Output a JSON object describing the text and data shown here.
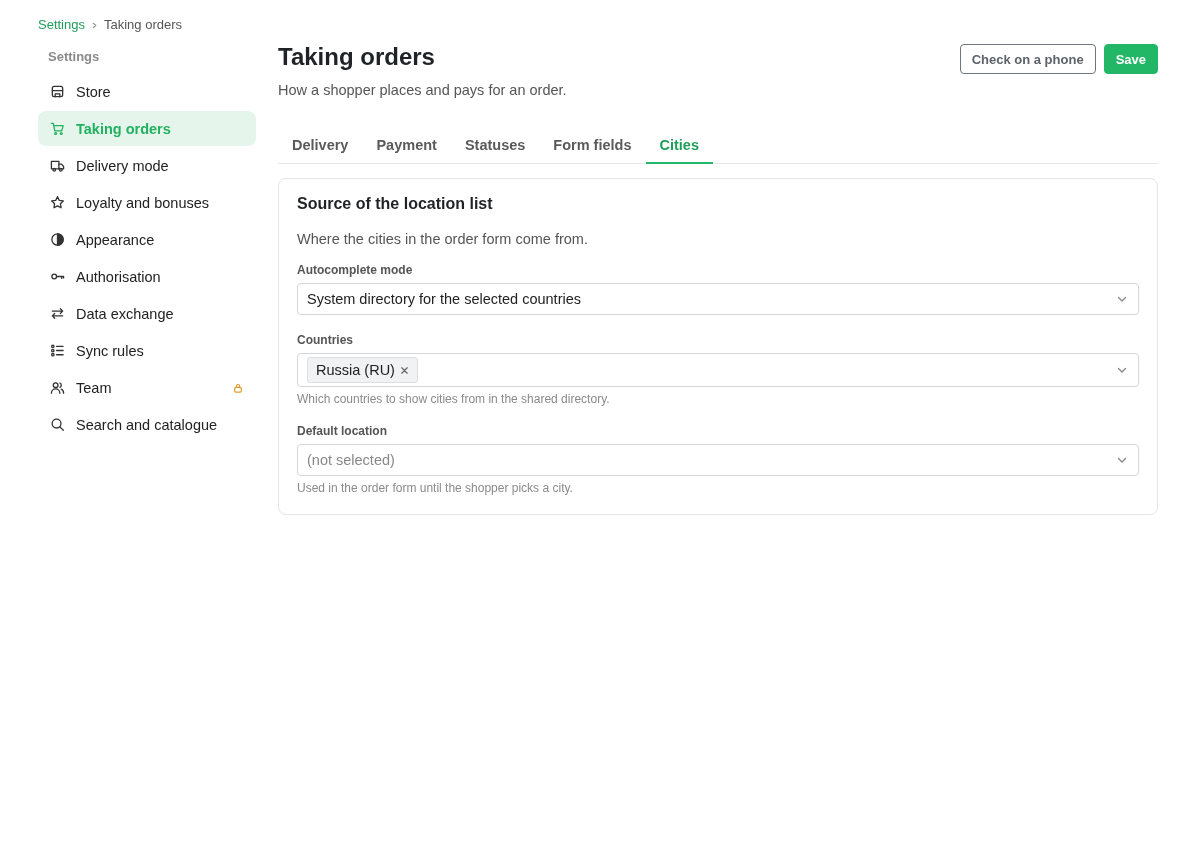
{
  "breadcrumb": [
    {
      "label": "Settings",
      "current": false
    },
    {
      "label": "Taking orders",
      "current": true
    }
  ],
  "sidebar": {
    "heading": "Settings",
    "items": [
      {
        "label": "Store",
        "selected": false,
        "locked": false
      },
      {
        "label": "Taking orders",
        "selected": true,
        "locked": false
      },
      {
        "label": "Delivery mode",
        "selected": false,
        "locked": false
      },
      {
        "label": "Loyalty and bonuses",
        "selected": false,
        "locked": false
      },
      {
        "label": "Appearance",
        "selected": false,
        "locked": false
      },
      {
        "label": "Authorisation",
        "selected": false,
        "locked": false
      },
      {
        "label": "Data exchange",
        "selected": false,
        "locked": false
      },
      {
        "label": "Sync rules",
        "selected": false,
        "locked": false
      },
      {
        "label": "Team",
        "selected": false,
        "locked": true
      },
      {
        "label": "Search and catalogue",
        "selected": false,
        "locked": false
      }
    ]
  },
  "header": {
    "title": "Taking orders",
    "subtitle": "How a shopper places and pays for an order.",
    "buttons": [
      {
        "label": "Check on a phone",
        "kind": "secondary"
      },
      {
        "label": "Save",
        "kind": "primary"
      }
    ]
  },
  "tabs": [
    {
      "label": "Delivery",
      "selected": false
    },
    {
      "label": "Payment",
      "selected": false
    },
    {
      "label": "Statuses",
      "selected": false
    },
    {
      "label": "Form fields",
      "selected": false
    },
    {
      "label": "Cities",
      "selected": true
    }
  ],
  "card": {
    "title": "Source of the location list",
    "description": "Where the cities in the order form come from.",
    "fields": [
      {
        "kind": "select",
        "label": "Autocomplete mode",
        "value": "System directory for the selected countries"
      },
      {
        "kind": "multiselect",
        "label": "Countries",
        "tags": [
          "Russia (RU)"
        ],
        "hint": "Which countries to show cities from in the shared directory."
      },
      {
        "kind": "select",
        "label": "Default location",
        "placeholder": "(not selected)",
        "hint": "Used in the order form until the shopper picks a city."
      }
    ]
  }
}
